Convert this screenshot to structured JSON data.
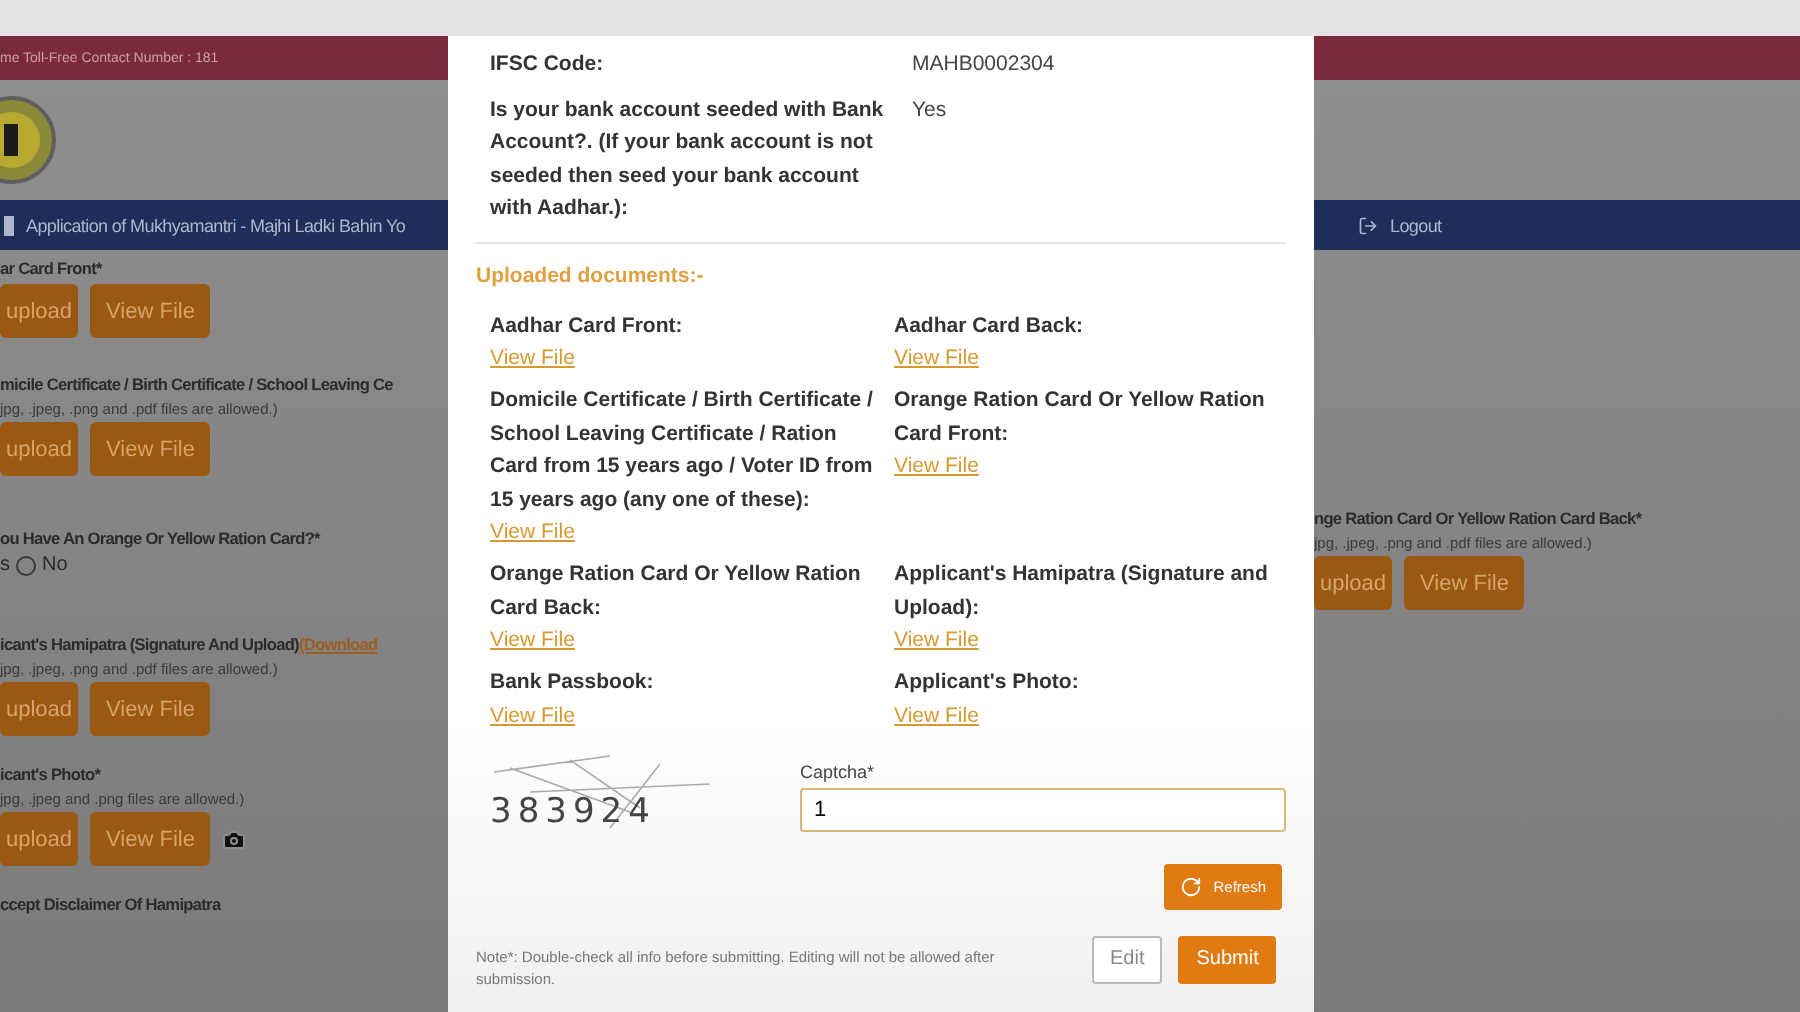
{
  "background": {
    "contact_text": "me Toll-Free Contact Number : 181",
    "nav_title": "Application of Mukhyamantri - Majhi Ladki Bahin Yo",
    "logout": "Logout",
    "left_fields": [
      {
        "kind": "upload",
        "label": "ar Card Front*",
        "buttons": [
          "upload",
          "View File"
        ]
      },
      {
        "kind": "upload",
        "label": "micile Certificate / Birth Certificate / School Leaving Ce",
        "hint": "jpg, .jpeg, .png and .pdf files are allowed.)",
        "buttons": [
          "upload",
          "View File"
        ]
      },
      {
        "kind": "radio",
        "label": "ou Have An Orange Or Yellow Ration Card?*",
        "partial_option": "s",
        "options": [
          {
            "label": "No",
            "selected": false
          }
        ]
      },
      {
        "kind": "upload",
        "label": "icant's Hamipatra (Signature And Upload)",
        "link": "(Download",
        "hint": "jpg, .jpeg, .png and .pdf files are allowed.)",
        "buttons": [
          "upload",
          "View File"
        ]
      },
      {
        "kind": "upload",
        "label": "icant's Photo*",
        "hint": "jpg, .jpeg and .png files are allowed.)",
        "buttons": [
          "upload",
          "View File"
        ],
        "camera": true
      },
      {
        "kind": "text",
        "label": "ccept Disclaimer Of Hamipatra"
      }
    ],
    "right_fields": [
      {
        "kind": "upload",
        "label": "nge Ration Card Or Yellow Ration Card Back*",
        "hint": "jpg, .jpeg, .png and .pdf files are allowed.)",
        "buttons": [
          "upload",
          "View File"
        ]
      }
    ]
  },
  "dialog": {
    "details": [
      {
        "label": "IFSC Code:",
        "value": "MAHB0002304"
      },
      {
        "label": "Is your bank account seeded with Bank Account?. (If your bank account is not seeded then seed your bank account with Aadhar.):",
        "value": "Yes"
      }
    ],
    "documents_heading": "Uploaded documents:-",
    "documents": [
      {
        "label": "Aadhar Card Front:",
        "link": "View File"
      },
      {
        "label": "Aadhar Card Back:",
        "link": "View File"
      },
      {
        "label": "Domicile Certificate / Birth Certificate / School Leaving Certificate / Ration Card from 15 years ago / Voter ID from 15 years ago (any one of these):",
        "link": "View File"
      },
      {
        "label": "Orange Ration Card Or Yellow Ration Card Front:",
        "link": "View File"
      },
      {
        "label": "Orange Ration Card Or Yellow Ration Card Back:",
        "link": "View File"
      },
      {
        "label": "Applicant's Hamipatra (Signature and Upload):",
        "link": "View File"
      },
      {
        "label": "Bank Passbook:",
        "link": "View File"
      },
      {
        "label": "Applicant's Photo:",
        "link": "View File"
      }
    ],
    "captcha": {
      "code": "383924",
      "label": "Captcha*",
      "value": "1"
    },
    "refresh_button": "Refresh",
    "note": "Note*: Double-check all info before submitting. Editing will not be allowed after submission.",
    "buttons": [
      {
        "label": "Edit",
        "kind": "outline"
      },
      {
        "label": "Submit",
        "kind": "primary"
      }
    ]
  }
}
